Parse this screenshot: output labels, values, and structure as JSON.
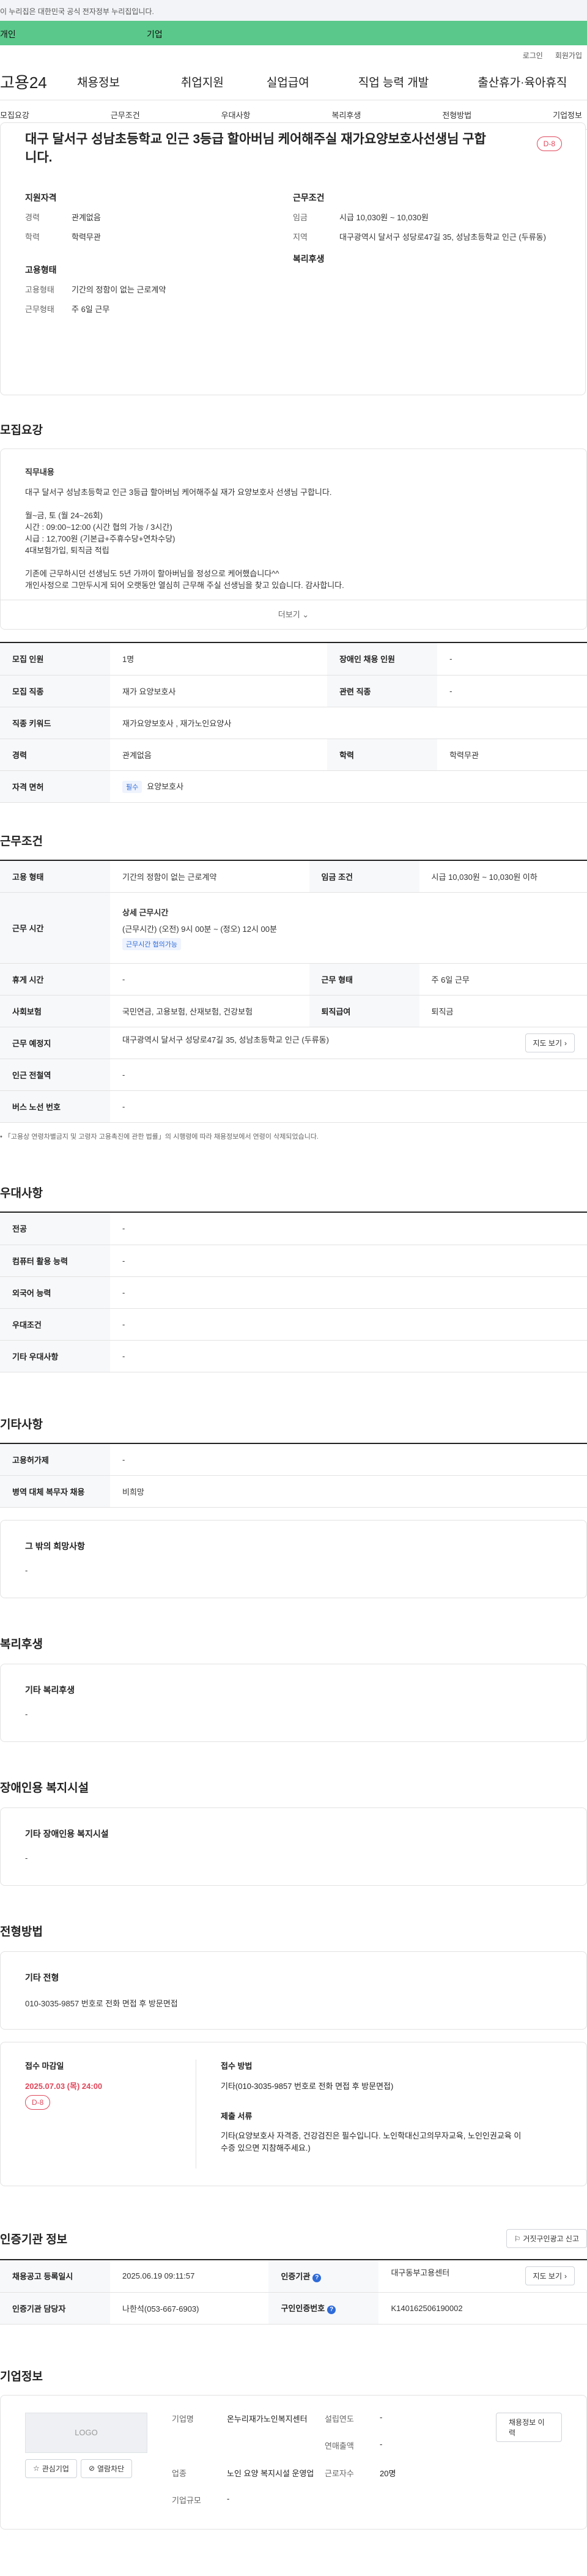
{
  "gov_banner": "이 누리집은 대한민국 공식 전자정부 누리집입니다.",
  "top_tabs": [
    "개인",
    "기업"
  ],
  "util": [
    "로그인",
    "회원가입"
  ],
  "logo": "고용24",
  "gnb": [
    "채용정보",
    "취업지원",
    "실업급여",
    "직업 능력 개발",
    "출산휴가·육아휴직"
  ],
  "anchor_tabs": [
    "모집요강",
    "근무조건",
    "우대사항",
    "복리후생",
    "전형방법",
    "기업정보"
  ],
  "summary": {
    "title": "대구 달서구 성남초등학교 인근 3등급 할아버님 케어해주실 재가요양보호사선생님 구합니다.",
    "dday": "D-8",
    "left_h": "지원자격",
    "left": [
      {
        "k": "경력",
        "v": "관계없음"
      },
      {
        "k": "학력",
        "v": "학력무관"
      }
    ],
    "right_h": "근무조건",
    "right": [
      {
        "k": "임금",
        "v": "시급 10,030원 ~ 10,030원"
      },
      {
        "k": "지역",
        "v": "대구광역시 달서구 성당로47길 35, 성남초등학교 인근 (두류동)"
      }
    ],
    "emp_h": "고용형태",
    "emp": [
      {
        "k": "고용형태",
        "v": "기간의 정함이 없는 근로계약"
      },
      {
        "k": "근무형태",
        "v": "주 6일 근무"
      }
    ],
    "welfare_h": "복리후생"
  },
  "recruit": {
    "title": "모집요강",
    "desc_title": "직무내용",
    "desc": [
      "대구 달서구 성남초등학교 인근 3등급 할아버님 케어해주실 재가 요양보호사 선생님 구합니다.",
      "",
      "월~금, 토 (월 24~26회)",
      "시간 : 09:00~12:00 (시간 협의 가능 / 3시간)",
      "시급 : 12,700원 (기본급+주휴수당+연차수당)",
      "4대보험가입, 퇴직금 적립",
      "",
      "기존에 근무하시던 선생님도 5년 가까이 할아버님을 정성으로 케어했습니다^^",
      "개인사정으로 그만두시게 되어 오랫동안 열심히 근무해 주실 선생님을 찾고 있습니다. 감사합니다."
    ],
    "more": "더보기",
    "rows": [
      {
        "k1": "모집 인원",
        "v1": "1명",
        "k2": "장애인 채용 인원",
        "v2": "-"
      },
      {
        "k1": "모집 직종",
        "v1": "재가 요양보호사",
        "k2": "관련 직종",
        "v2": "-"
      },
      {
        "k1": "직종 키워드",
        "v1": "재가요양보호사 , 재가노인요양사"
      },
      {
        "k1": "경력",
        "v1": "관계없음",
        "k2": "학력",
        "v2": "학력무관"
      },
      {
        "k1": "자격 면허",
        "tag": "필수",
        "v1": "요양보호사"
      }
    ]
  },
  "cond": {
    "title": "근무조건",
    "emp_k": "고용 형태",
    "emp_v": "기간의 정함이 없는 근로계약",
    "wage_k": "임금 조건",
    "wage_v": "시급 10,030원 ~ 10,030원 이하",
    "time_k": "근무 시간",
    "time_h": "상세 근무시간",
    "time_v": "(근무시간) (오전) 9시 00분 ~ (정오) 12시 00분",
    "time_tag": "근무시간 협의가능",
    "rest_k": "휴게 시간",
    "rest_v": "-",
    "type_k": "근무 형태",
    "type_v": "주 6일 근무",
    "ins_k": "사회보험",
    "ins_v": "국민연금, 고용보험, 산재보험, 건강보험",
    "ret_k": "퇴직급여",
    "ret_v": "퇴직금",
    "loc_k": "근무 예정지",
    "loc_v": "대구광역시 달서구 성당로47길 35, 성남초등학교 인근 (두류동)",
    "map_btn": "지도 보기",
    "sub_k": "인근 전철역",
    "sub_v": "-",
    "bus_k": "버스 노선 번호",
    "bus_v": "-",
    "note": "「고용상 연령차별금지 및 고령자 고용촉진에 관한 법률」의 시행령에 따라 채용정보에서 연령이 삭제되었습니다."
  },
  "pref": {
    "title": "우대사항",
    "rows": [
      {
        "k": "전공",
        "v": "-"
      },
      {
        "k": "컴퓨터 활용 능력",
        "v": "-"
      },
      {
        "k": "외국어 능력",
        "v": "-"
      },
      {
        "k": "우대조건",
        "v": "-"
      },
      {
        "k": "기타 우대사항",
        "v": "-"
      }
    ]
  },
  "etc": {
    "title": "기타사항",
    "rows": [
      {
        "k": "고용허가제",
        "v": "-"
      },
      {
        "k": "병역 대체 복무자 채용",
        "v": "비희망"
      }
    ],
    "box_t": "그 밖의 희망사항",
    "box_v": "-"
  },
  "welfare": {
    "title": "복리후생",
    "box_t": "기타 복리후생",
    "box_v": "-"
  },
  "disab": {
    "title": "장애인용 복지시설",
    "box_t": "기타 장애인용 복지시설",
    "box_v": "-"
  },
  "process": {
    "title": "전형방법",
    "box_t": "기타 전형",
    "box_v": "010-3035-9857 번호로 전화 면접 후 방문면접",
    "deadline_k": "접수 마감일",
    "deadline_v": "2025.07.03 (목) 24:00",
    "dday": "D-8",
    "method_k": "접수 방법",
    "method_v": "기타(010-3035-9857 번호로 전화 면접 후 방문면접)",
    "docs_k": "제출 서류",
    "docs_v": "기타(요양보호사 자격증, 건강검진은 필수입니다. 노인학대신고의무자교육, 노인인권교육 이수증 있으면 지참해주세요.)"
  },
  "agency": {
    "title": "인증기관 정보",
    "report_btn": "거짓구인광고 신고",
    "reg_k": "채용공고 등록일시",
    "reg_v": "2025.06.19 09:11:57",
    "org_k": "인증기관",
    "org_v": "대구동부고용센터",
    "map_btn": "지도 보기",
    "mgr_k": "인증기관 담당자",
    "mgr_v": "나한석(053-667-6903)",
    "id_k": "구인인증번호",
    "id_v": "K140162506190002"
  },
  "company": {
    "title": "기업정보",
    "logo_text": "LOGO",
    "fav_btn": "관심기업",
    "block_btn": "열람차단",
    "name_k": "기업명",
    "name_v": "온누리재가노인복지센터",
    "year_k": "설립연도",
    "year_v": "-",
    "view_btn": "채용정보 이력",
    "sales_k": "연매출액",
    "sales_v": "-",
    "ind_k": "업종",
    "ind_v": "노인 요양 복지시설 운영업",
    "staff_k": "근로자수",
    "staff_v": "20명",
    "scale_k": "기업규모",
    "scale_v": "-"
  }
}
